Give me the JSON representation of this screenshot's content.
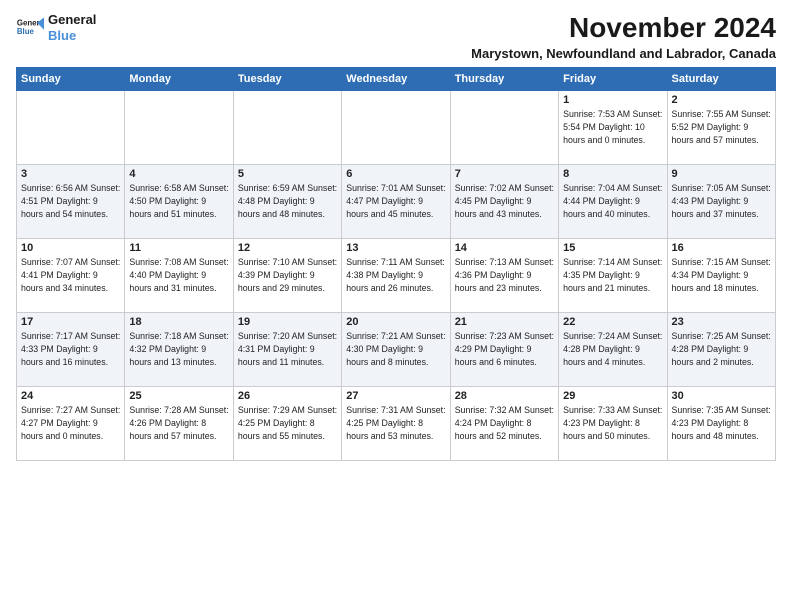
{
  "header": {
    "logo_line1": "General",
    "logo_line2": "Blue",
    "month_title": "November 2024",
    "location": "Marystown, Newfoundland and Labrador, Canada"
  },
  "weekdays": [
    "Sunday",
    "Monday",
    "Tuesday",
    "Wednesday",
    "Thursday",
    "Friday",
    "Saturday"
  ],
  "weeks": [
    [
      {
        "day": "",
        "info": ""
      },
      {
        "day": "",
        "info": ""
      },
      {
        "day": "",
        "info": ""
      },
      {
        "day": "",
        "info": ""
      },
      {
        "day": "",
        "info": ""
      },
      {
        "day": "1",
        "info": "Sunrise: 7:53 AM\nSunset: 5:54 PM\nDaylight: 10 hours\nand 0 minutes."
      },
      {
        "day": "2",
        "info": "Sunrise: 7:55 AM\nSunset: 5:52 PM\nDaylight: 9 hours\nand 57 minutes."
      }
    ],
    [
      {
        "day": "3",
        "info": "Sunrise: 6:56 AM\nSunset: 4:51 PM\nDaylight: 9 hours\nand 54 minutes."
      },
      {
        "day": "4",
        "info": "Sunrise: 6:58 AM\nSunset: 4:50 PM\nDaylight: 9 hours\nand 51 minutes."
      },
      {
        "day": "5",
        "info": "Sunrise: 6:59 AM\nSunset: 4:48 PM\nDaylight: 9 hours\nand 48 minutes."
      },
      {
        "day": "6",
        "info": "Sunrise: 7:01 AM\nSunset: 4:47 PM\nDaylight: 9 hours\nand 45 minutes."
      },
      {
        "day": "7",
        "info": "Sunrise: 7:02 AM\nSunset: 4:45 PM\nDaylight: 9 hours\nand 43 minutes."
      },
      {
        "day": "8",
        "info": "Sunrise: 7:04 AM\nSunset: 4:44 PM\nDaylight: 9 hours\nand 40 minutes."
      },
      {
        "day": "9",
        "info": "Sunrise: 7:05 AM\nSunset: 4:43 PM\nDaylight: 9 hours\nand 37 minutes."
      }
    ],
    [
      {
        "day": "10",
        "info": "Sunrise: 7:07 AM\nSunset: 4:41 PM\nDaylight: 9 hours\nand 34 minutes."
      },
      {
        "day": "11",
        "info": "Sunrise: 7:08 AM\nSunset: 4:40 PM\nDaylight: 9 hours\nand 31 minutes."
      },
      {
        "day": "12",
        "info": "Sunrise: 7:10 AM\nSunset: 4:39 PM\nDaylight: 9 hours\nand 29 minutes."
      },
      {
        "day": "13",
        "info": "Sunrise: 7:11 AM\nSunset: 4:38 PM\nDaylight: 9 hours\nand 26 minutes."
      },
      {
        "day": "14",
        "info": "Sunrise: 7:13 AM\nSunset: 4:36 PM\nDaylight: 9 hours\nand 23 minutes."
      },
      {
        "day": "15",
        "info": "Sunrise: 7:14 AM\nSunset: 4:35 PM\nDaylight: 9 hours\nand 21 minutes."
      },
      {
        "day": "16",
        "info": "Sunrise: 7:15 AM\nSunset: 4:34 PM\nDaylight: 9 hours\nand 18 minutes."
      }
    ],
    [
      {
        "day": "17",
        "info": "Sunrise: 7:17 AM\nSunset: 4:33 PM\nDaylight: 9 hours\nand 16 minutes."
      },
      {
        "day": "18",
        "info": "Sunrise: 7:18 AM\nSunset: 4:32 PM\nDaylight: 9 hours\nand 13 minutes."
      },
      {
        "day": "19",
        "info": "Sunrise: 7:20 AM\nSunset: 4:31 PM\nDaylight: 9 hours\nand 11 minutes."
      },
      {
        "day": "20",
        "info": "Sunrise: 7:21 AM\nSunset: 4:30 PM\nDaylight: 9 hours\nand 8 minutes."
      },
      {
        "day": "21",
        "info": "Sunrise: 7:23 AM\nSunset: 4:29 PM\nDaylight: 9 hours\nand 6 minutes."
      },
      {
        "day": "22",
        "info": "Sunrise: 7:24 AM\nSunset: 4:28 PM\nDaylight: 9 hours\nand 4 minutes."
      },
      {
        "day": "23",
        "info": "Sunrise: 7:25 AM\nSunset: 4:28 PM\nDaylight: 9 hours\nand 2 minutes."
      }
    ],
    [
      {
        "day": "24",
        "info": "Sunrise: 7:27 AM\nSunset: 4:27 PM\nDaylight: 9 hours\nand 0 minutes."
      },
      {
        "day": "25",
        "info": "Sunrise: 7:28 AM\nSunset: 4:26 PM\nDaylight: 8 hours\nand 57 minutes."
      },
      {
        "day": "26",
        "info": "Sunrise: 7:29 AM\nSunset: 4:25 PM\nDaylight: 8 hours\nand 55 minutes."
      },
      {
        "day": "27",
        "info": "Sunrise: 7:31 AM\nSunset: 4:25 PM\nDaylight: 8 hours\nand 53 minutes."
      },
      {
        "day": "28",
        "info": "Sunrise: 7:32 AM\nSunset: 4:24 PM\nDaylight: 8 hours\nand 52 minutes."
      },
      {
        "day": "29",
        "info": "Sunrise: 7:33 AM\nSunset: 4:23 PM\nDaylight: 8 hours\nand 50 minutes."
      },
      {
        "day": "30",
        "info": "Sunrise: 7:35 AM\nSunset: 4:23 PM\nDaylight: 8 hours\nand 48 minutes."
      }
    ]
  ]
}
